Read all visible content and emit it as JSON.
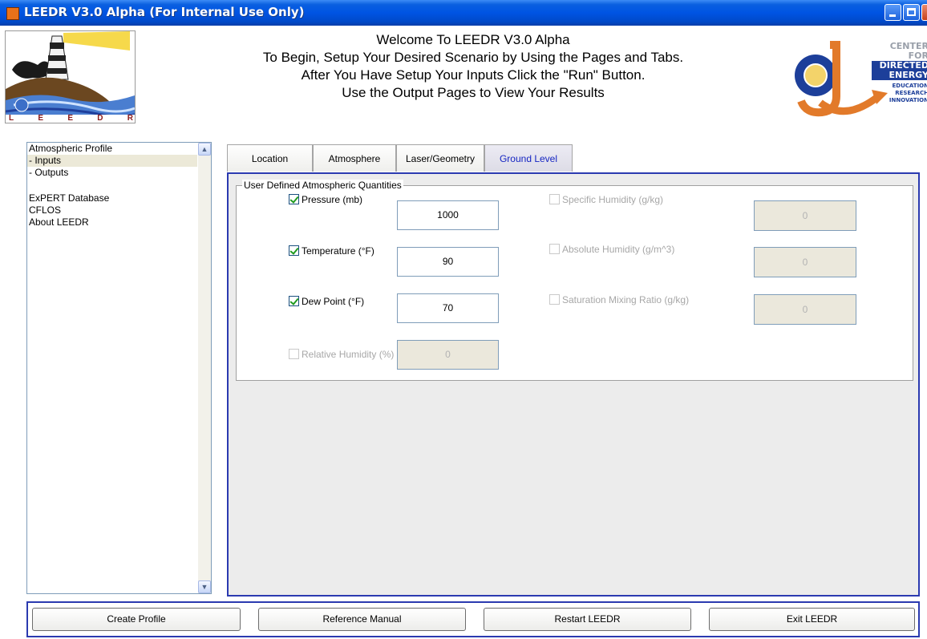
{
  "window": {
    "title": "LEEDR V3.0 Alpha (For Internal Use Only)"
  },
  "header": {
    "lines": [
      "Welcome To LEEDR V3.0 Alpha",
      "To Begin, Setup Your Desired Scenario by Using the Pages and Tabs.",
      "After You Have Setup Your Inputs Click the \"Run\" Button.",
      "Use the Output Pages to View Your Results"
    ],
    "left_logo_letters": [
      "L",
      "E",
      "E",
      "D",
      "R"
    ],
    "right_logo": {
      "line1": "CENTER",
      "line2": "FOR",
      "line3": "DIRECTED",
      "line4": "ENERGY",
      "line5": "EDUCATION",
      "line6": "RESEARCH",
      "line7": "INNOVATION"
    }
  },
  "sidebar": {
    "items": [
      {
        "label": "Atmospheric Profile"
      },
      {
        "label": " - Inputs",
        "selected": true
      },
      {
        "label": " - Outputs"
      },
      {
        "label": "ExPERT Database"
      },
      {
        "label": "CFLOS"
      },
      {
        "label": "About LEEDR"
      }
    ]
  },
  "tabs": [
    {
      "label": "Location"
    },
    {
      "label": "Atmosphere"
    },
    {
      "label": "Laser/Geometry"
    },
    {
      "label": "Ground Level",
      "active": true
    }
  ],
  "group": {
    "title": "User Defined Atmospheric Quantities",
    "pressure": {
      "label": "Pressure (mb)",
      "value": "1000",
      "checked": true
    },
    "temperature": {
      "label": "Temperature (°F)",
      "value": "90",
      "checked": true
    },
    "dew_point": {
      "label": "Dew Point (°F)",
      "value": "70",
      "checked": true
    },
    "relative_humidity": {
      "label": "Relative Humidity (%)",
      "value": "0",
      "checked": false
    },
    "specific_humidity": {
      "label": "Specific Humidity (g/kg)",
      "value": "0",
      "checked": false
    },
    "absolute_humidity": {
      "label": "Absolute Humidity (g/m^3)",
      "value": "0",
      "checked": false
    },
    "saturation_mixing_ratio": {
      "label": "Saturation Mixing Ratio (g/kg)",
      "value": "0",
      "checked": false
    }
  },
  "buttons": {
    "create_profile": "Create Profile",
    "reference_manual": "Reference Manual",
    "restart": "Restart LEEDR",
    "exit": "Exit LEEDR"
  },
  "colors": {
    "titlebar": "#0054e3",
    "panel_border": "#2b3ab0",
    "active_tab_text": "#1525c2"
  }
}
